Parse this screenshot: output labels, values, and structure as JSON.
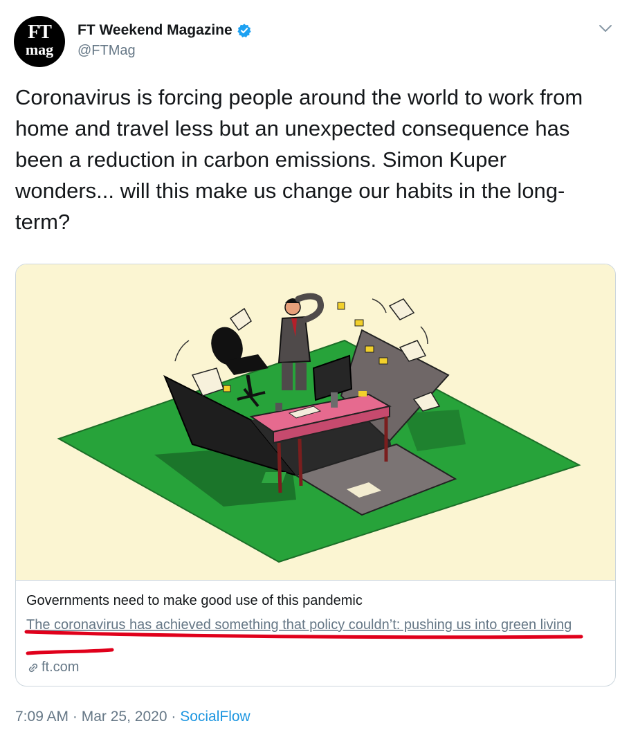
{
  "author": {
    "avatar_line1": "FT",
    "avatar_line2": "mag",
    "name": "FT Weekend Magazine",
    "handle": "@FTMag",
    "verified": true
  },
  "tweet": {
    "text": "Coronavirus is forcing people around the world to work from home and travel less but an unexpected consequence has been a reduction in carbon emissions. Simon Kuper wonders... will this make us change our habits in the long-term?"
  },
  "card": {
    "title": "Governments need to make good use of this pandemic",
    "description": "The coronavirus has achieved something that policy couldn’t: pushing us into green living",
    "domain": "ft.com",
    "image_subject": "isometric office desk with computer, chair and man on green square being opened like a box, with papers flying"
  },
  "meta": {
    "time": "7:09 AM",
    "separator": "·",
    "date": "Mar 25, 2020",
    "source": "SocialFlow"
  },
  "colors": {
    "text_primary": "#14171a",
    "text_secondary": "#657786",
    "link_blue": "#1b95e0",
    "verified_blue": "#1da1f2",
    "card_border": "#ccd6dd",
    "image_background": "#fbf5d2",
    "annotation_red": "#e0001b"
  },
  "icons": [
    "verified-badge-icon",
    "chevron-down-icon",
    "link-icon"
  ]
}
